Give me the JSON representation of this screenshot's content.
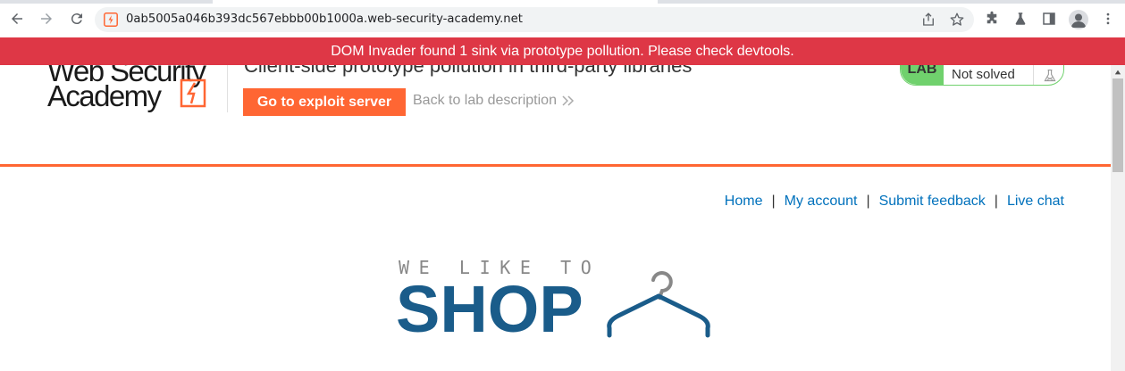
{
  "browser": {
    "url": "0ab5005a046b393dc567ebbb00b1000a.web-security-academy.net",
    "back_icon": "arrow-left-icon",
    "forward_icon": "arrow-right-icon",
    "reload_icon": "reload-icon"
  },
  "banner": {
    "text": "DOM Invader found 1 sink via prototype pollution. Please check devtools.",
    "color": "#de3746"
  },
  "lab": {
    "logo_line1": "Web Security",
    "logo_line2": "Academy",
    "title": "Client-side prototype pollution in third-party libraries",
    "exploit_button": "Go to exploit server",
    "back_link": "Back to lab description",
    "badge": "LAB",
    "status": "Not solved",
    "accent_color": "#ff6633",
    "status_color": "#70d16d"
  },
  "nav": {
    "items": [
      "Home",
      "My account",
      "Submit feedback",
      "Live chat"
    ],
    "separator": "|"
  },
  "shop": {
    "tagline": "WE LIKE TO",
    "name": "SHOP",
    "brand_color": "#1a5c8a"
  }
}
